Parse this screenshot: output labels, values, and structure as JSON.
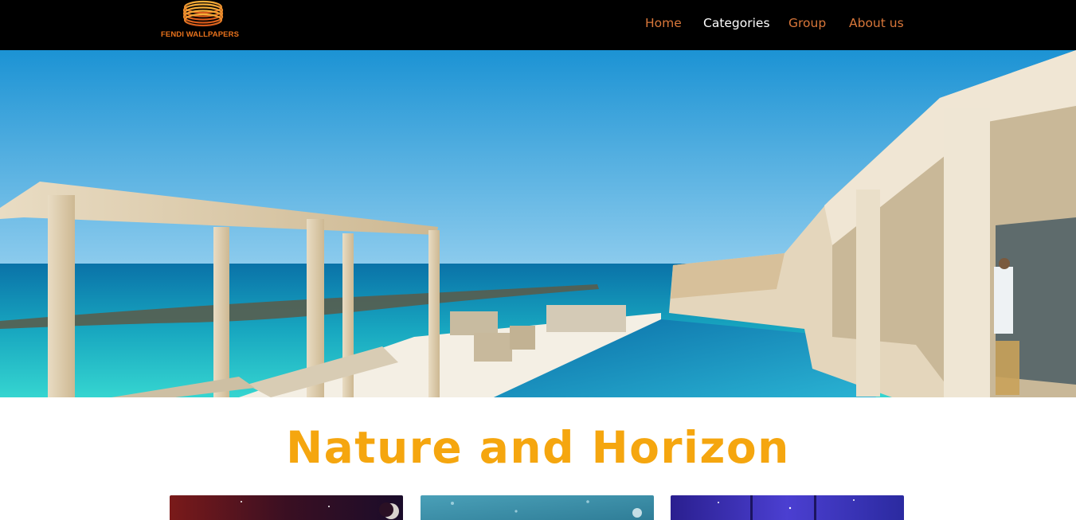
{
  "header": {
    "logo_text": "FENDI WALLPAPERS",
    "nav": [
      {
        "label": "Home",
        "active": false
      },
      {
        "label": "Categories",
        "active": true
      },
      {
        "label": "Group",
        "active": false
      },
      {
        "label": "About us",
        "active": false
      }
    ]
  },
  "hero": {
    "image_icon": "beach-villa-photo"
  },
  "section": {
    "title": "Nature and Horizon",
    "cards": [
      {
        "icon": "moonlit-sky-thumbnail"
      },
      {
        "icon": "rainy-window-thumbnail"
      },
      {
        "icon": "starry-forest-thumbnail"
      }
    ]
  },
  "colors": {
    "header_bg": "#000000",
    "nav_link": "#d9773a",
    "nav_active": "#ffffff",
    "title_accent": "#f5a60f"
  }
}
